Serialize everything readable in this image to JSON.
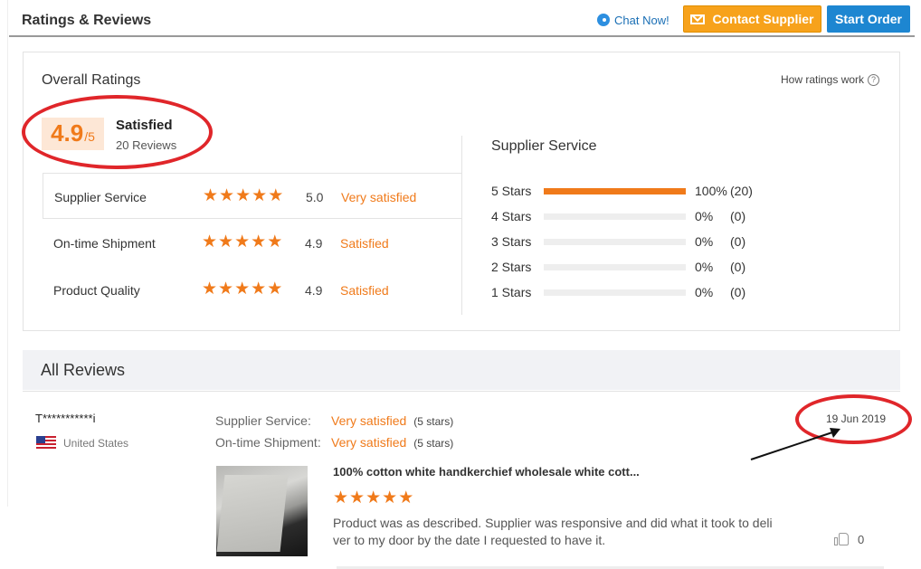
{
  "header": {
    "title": "Ratings & Reviews",
    "chat_label": "Chat Now!",
    "contact_label": "Contact Supplier",
    "start_order_label": "Start Order"
  },
  "overall": {
    "title": "Overall Ratings",
    "how_link": "How ratings work",
    "score": "4.9",
    "score_denominator": "/5",
    "satisfaction": "Satisfied",
    "reviews_count": "20 Reviews",
    "rows": [
      {
        "label": "Supplier Service",
        "score": "5.0",
        "text": "Very satisfied",
        "stars": 5
      },
      {
        "label": "On-time Shipment",
        "score": "4.9",
        "text": "Satisfied",
        "stars": 5
      },
      {
        "label": "Product Quality",
        "score": "4.9",
        "text": "Satisfied",
        "stars": 5
      }
    ]
  },
  "distribution": {
    "title": "Supplier Service",
    "rows": [
      {
        "label": "5  Stars",
        "pct_text": "100%",
        "count": "(20)",
        "fraction": 1.0
      },
      {
        "label": "4  Stars",
        "pct_text": "0%",
        "count": "(0)",
        "fraction": 0
      },
      {
        "label": "3  Stars",
        "pct_text": "0%",
        "count": "(0)",
        "fraction": 0
      },
      {
        "label": "2  Stars",
        "pct_text": "0%",
        "count": "(0)",
        "fraction": 0
      },
      {
        "label": "1  Stars",
        "pct_text": "0%",
        "count": "(0)",
        "fraction": 0
      }
    ]
  },
  "reviews": {
    "title": "All Reviews",
    "items": [
      {
        "reviewer": "T***********i",
        "country": "United States",
        "service_label": "Supplier Service:",
        "service_value": "Very satisfied",
        "service_stars": "(5 stars)",
        "shipment_label": "On-time Shipment:",
        "shipment_value": "Very satisfied",
        "shipment_stars": "(5 stars)",
        "date": "19 Jun 2019",
        "product_title": "100% cotton white handkerchief wholesale white cott...",
        "product_stars": 5,
        "comment": "Product was as described. Supplier was responsive and did what it took to deli ver to my door by the date I requested to have it.",
        "likes": "0"
      }
    ]
  },
  "colors": {
    "accent_orange": "#f07a1a",
    "contact_button": "#f7a21b",
    "start_button": "#1d86d1",
    "annotation_red": "#e0262a"
  },
  "icons": [
    "chat-icon",
    "mail-icon",
    "help-icon",
    "star-icon",
    "us-flag-icon",
    "thumbs-up-icon"
  ]
}
